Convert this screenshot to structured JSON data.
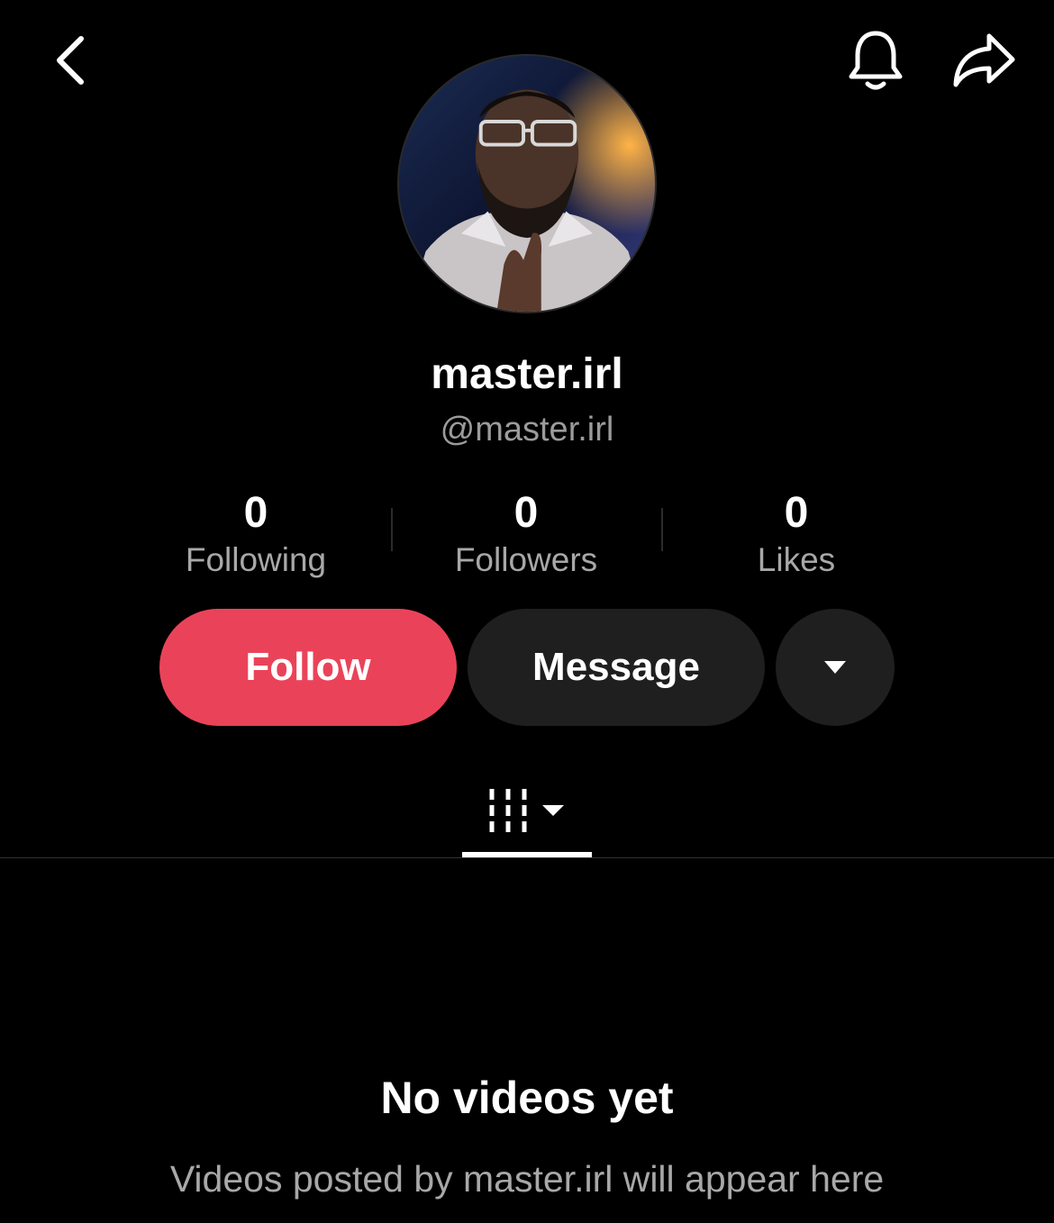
{
  "header": {
    "back_icon": "chevron-left-icon",
    "bell_icon": "bell-icon",
    "share_icon": "share-arrow-icon"
  },
  "profile": {
    "display_name": "master.irl",
    "handle": "@master.irl"
  },
  "stats": [
    {
      "value": "0",
      "label": "Following"
    },
    {
      "value": "0",
      "label": "Followers"
    },
    {
      "value": "0",
      "label": "Likes"
    }
  ],
  "actions": {
    "follow_label": "Follow",
    "message_label": "Message",
    "more_icon": "caret-down-icon"
  },
  "tabs": {
    "videos_icon": "grid-lines-icon"
  },
  "empty_state": {
    "title": "No videos yet",
    "subtitle": "Videos posted by master.irl will appear here"
  },
  "colors": {
    "background": "#000000",
    "follow": "#ea4359",
    "secondary_button": "#1f1f1f",
    "muted_text": "#a8a8a8"
  }
}
